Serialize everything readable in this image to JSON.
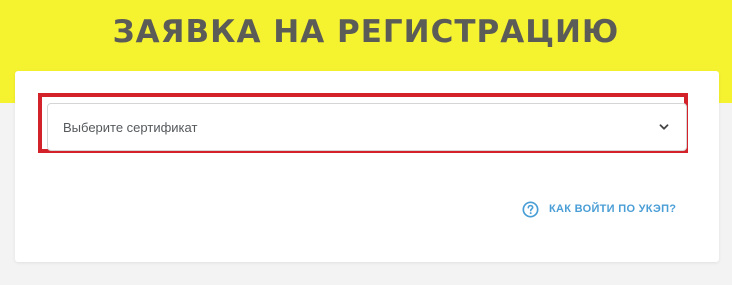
{
  "header": {
    "title": "ЗАЯВКА НА РЕГИСТРАЦИЮ"
  },
  "certificate_select": {
    "placeholder": "Выберите сертификат",
    "icon": "chevron-down-icon"
  },
  "help": {
    "label": "КАК ВОЙТИ ПО УКЭП?",
    "icon": "question-circle-icon"
  },
  "colors": {
    "header_band": "#f5f230",
    "title_text": "#5b5b57",
    "highlight_border": "#d3222a",
    "link": "#4a9ed6"
  }
}
